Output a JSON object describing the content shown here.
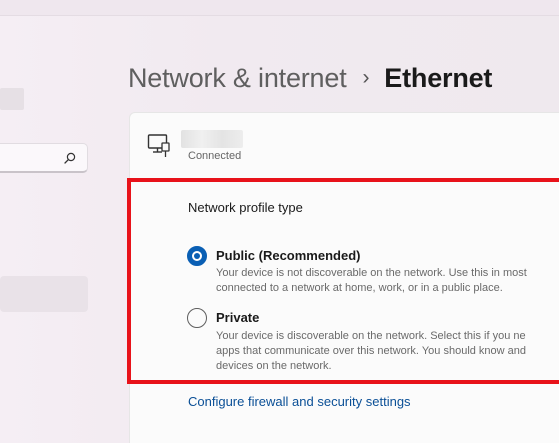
{
  "breadcrumb": {
    "parent": "Network & internet",
    "separator": "›",
    "current": "Ethernet"
  },
  "sidebar": {
    "search_icon": "search-icon"
  },
  "connection": {
    "icon": "ethernet-icon",
    "status": "Connected"
  },
  "profile": {
    "label": "Network profile type",
    "options": [
      {
        "title": "Public (Recommended)",
        "selected": true,
        "description": [
          "Your device is not discoverable on the network. Use this in most",
          "connected to a network at home, work, or in a public place."
        ]
      },
      {
        "title": "Private",
        "selected": false,
        "description": [
          "Your device is discoverable on the network. Select this if you ne",
          "apps that communicate over this network. You should know and",
          "devices on the network."
        ]
      }
    ]
  },
  "firewall_link": "Configure firewall and security settings",
  "colors": {
    "accent": "#0a5fb4",
    "highlight": "#e8121a",
    "link": "#0a4f96"
  }
}
